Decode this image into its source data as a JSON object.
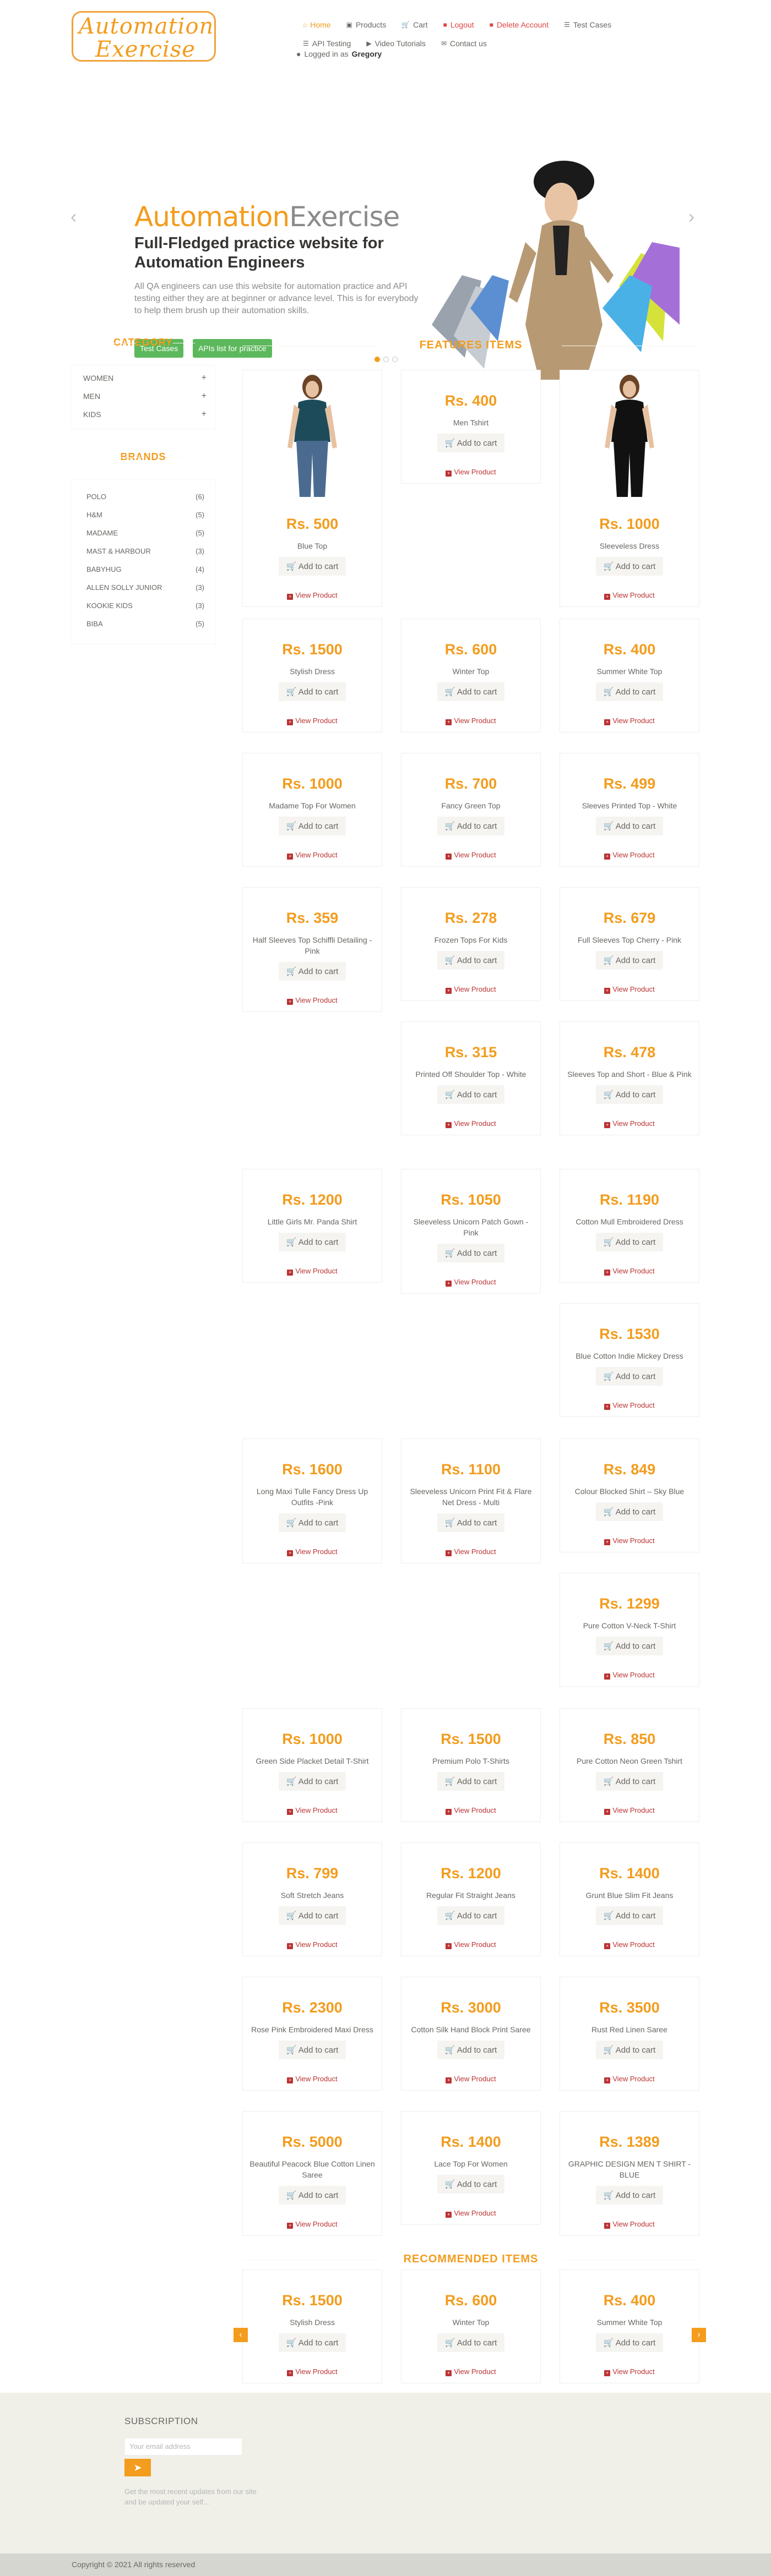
{
  "logo": {
    "line1": "Automation",
    "line2": "Exercise"
  },
  "nav": {
    "items": [
      {
        "icon": "home-icon",
        "label": "Home"
      },
      {
        "icon": "products-icon",
        "label": "Products"
      },
      {
        "icon": "cart-icon",
        "label": "Cart"
      },
      {
        "icon": "lock-icon",
        "label": "Logout"
      },
      {
        "icon": "trash-icon",
        "label": "Delete Account"
      },
      {
        "icon": "list-icon",
        "label": "Test Cases"
      }
    ],
    "items2": [
      {
        "icon": "list-icon",
        "label": "API Testing"
      },
      {
        "icon": "youtube-icon",
        "label": "Video Tutorials"
      },
      {
        "icon": "envelope-icon",
        "label": "Contact us"
      }
    ],
    "logged_prefix": "Logged in as",
    "logged_user": "Gregory"
  },
  "slider": {
    "title_a": "Automation",
    "title_b": "Exercise",
    "heading": "Full-Fledged practice website for Automation Engineers",
    "text": "All QA engineers can use this website for automation practice and API testing either they are at beginner or advance level. This is for everybody to help them brush up their automation skills.",
    "btn1": "Test Cases",
    "btn2": "APIs list for practice",
    "dots": 3,
    "active_dot": 0
  },
  "sidebar": {
    "category_title": "CATEGORY",
    "categories": [
      "Women",
      "Men",
      "Kids"
    ],
    "brands_title": "BRANDS",
    "brands": [
      {
        "name": "Polo",
        "count": "(6)"
      },
      {
        "name": "H&M",
        "count": "(5)"
      },
      {
        "name": "Madame",
        "count": "(5)"
      },
      {
        "name": "Mast & Harbour",
        "count": "(3)"
      },
      {
        "name": "Babyhug",
        "count": "(4)"
      },
      {
        "name": "Allen Solly Junior",
        "count": "(3)"
      },
      {
        "name": "Kookie Kids",
        "count": "(3)"
      },
      {
        "name": "Biba",
        "count": "(5)"
      }
    ]
  },
  "features": {
    "title": "FEATURES ITEMS",
    "add_to_cart": "Add to cart",
    "view_product": "View Product",
    "products": [
      {
        "price": "Rs. 500",
        "name": "Blue Top",
        "img": "woman-teal"
      },
      {
        "price": "Rs. 400",
        "name": "Men Tshirt"
      },
      {
        "price": "Rs. 1000",
        "name": "Sleeveless Dress",
        "img": "woman-black"
      },
      {
        "price": "Rs. 1500",
        "name": "Stylish Dress"
      },
      {
        "price": "Rs. 600",
        "name": "Winter Top"
      },
      {
        "price": "Rs. 400",
        "name": "Summer White Top"
      },
      {
        "price": "Rs. 1000",
        "name": "Madame Top For Women"
      },
      {
        "price": "Rs. 700",
        "name": "Fancy Green Top"
      },
      {
        "price": "Rs. 499",
        "name": "Sleeves Printed Top - White"
      },
      {
        "price": "Rs. 359",
        "name": "Half Sleeves Top Schiffli Detailing - Pink"
      },
      {
        "price": "Rs. 278",
        "name": "Frozen Tops For Kids"
      },
      {
        "price": "Rs. 679",
        "name": "Full Sleeves Top Cherry - Pink"
      },
      {
        "price": "Rs. 315",
        "name": "Printed Off Shoulder Top - White"
      },
      {
        "price": "Rs. 478",
        "name": "Sleeves Top and Short - Blue & Pink"
      },
      {
        "price": "Rs. 1200",
        "name": "Little Girls Mr. Panda Shirt"
      },
      {
        "price": "Rs. 1050",
        "name": "Sleeveless Unicorn Patch Gown - Pink"
      },
      {
        "price": "Rs. 1190",
        "name": "Cotton Mull Embroidered Dress"
      },
      {
        "price": "Rs. 1530",
        "name": "Blue Cotton Indie Mickey Dress"
      },
      {
        "price": "Rs. 1600",
        "name": "Long Maxi Tulle Fancy Dress Up Outfits -Pink"
      },
      {
        "price": "Rs. 1100",
        "name": "Sleeveless Unicorn Print Fit & Flare Net Dress - Multi"
      },
      {
        "price": "Rs. 849",
        "name": "Colour Blocked Shirt – Sky Blue"
      },
      {
        "price": "Rs. 1299",
        "name": "Pure Cotton V-Neck T-Shirt"
      },
      {
        "price": "Rs. 1000",
        "name": "Green Side Placket Detail T-Shirt"
      },
      {
        "price": "Rs. 1500",
        "name": "Premium Polo T-Shirts"
      },
      {
        "price": "Rs. 850",
        "name": "Pure Cotton Neon Green Tshirt"
      },
      {
        "price": "Rs. 799",
        "name": "Soft Stretch Jeans"
      },
      {
        "price": "Rs. 1200",
        "name": "Regular Fit Straight Jeans"
      },
      {
        "price": "Rs. 1400",
        "name": "Grunt Blue Slim Fit Jeans"
      },
      {
        "price": "Rs. 2300",
        "name": "Rose Pink Embroidered Maxi Dress"
      },
      {
        "price": "Rs. 3000",
        "name": "Cotton Silk Hand Block Print Saree"
      },
      {
        "price": "Rs. 3500",
        "name": "Rust Red Linen Saree"
      },
      {
        "price": "Rs. 5000",
        "name": "Beautiful Peacock Blue Cotton Linen Saree"
      },
      {
        "price": "Rs. 1400",
        "name": "Lace Top For Women"
      },
      {
        "price": "Rs. 1389",
        "name": "GRAPHIC DESIGN MEN T SHIRT - BLUE"
      }
    ]
  },
  "recommended": {
    "title": "RECOMMENDED ITEMS",
    "products": [
      {
        "price": "Rs. 1500",
        "name": "Stylish Dress"
      },
      {
        "price": "Rs. 600",
        "name": "Winter Top"
      },
      {
        "price": "Rs. 400",
        "name": "Summer White Top"
      }
    ]
  },
  "footer": {
    "subscription_title": "SUBSCRIPTION",
    "email_placeholder": "Your email address",
    "text": "Get the most recent updates from our site and be updated your self...",
    "copyright": "Copyright © 2021 All rights reserved"
  },
  "colors": {
    "accent": "#f39c1d",
    "green": "#5cb85c",
    "view_red": "#b33333"
  }
}
